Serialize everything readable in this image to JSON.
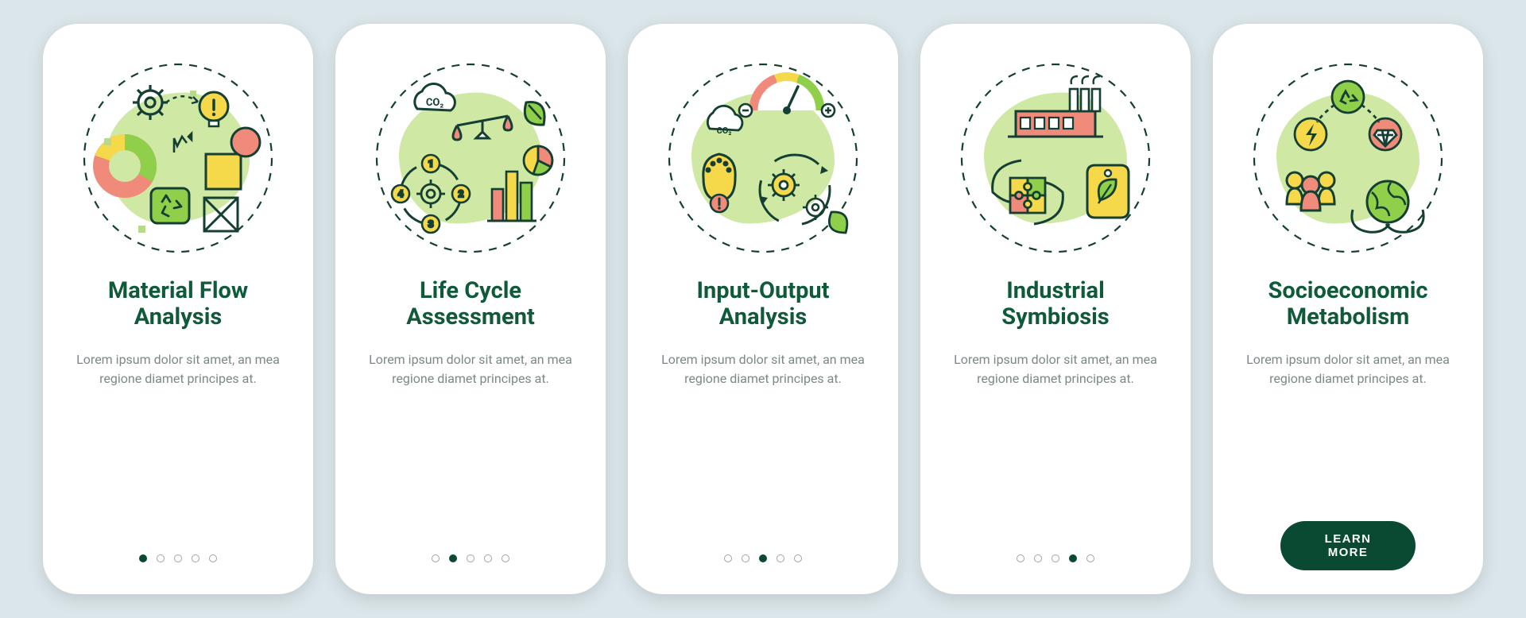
{
  "slide_count": 5,
  "description": "Lorem ipsum dolor sit amet, an mea regione diamet principes at.",
  "cta_label": "LEARN MORE",
  "colors": {
    "dark_green": "#0f5a3a",
    "leaf_green": "#8fcf4a",
    "light_green": "#cfe9a4",
    "yellow": "#f6d94b",
    "red": "#f08a7a",
    "outline": "#153f33"
  },
  "slides": [
    {
      "title": "Material Flow Analysis",
      "icon": "material-flow-analysis-icon",
      "active_index": 0
    },
    {
      "title": "Life Cycle Assessment",
      "icon": "life-cycle-assessment-icon",
      "active_index": 1
    },
    {
      "title": "Input-Output Analysis",
      "icon": "input-output-analysis-icon",
      "active_index": 2
    },
    {
      "title": "Industrial Symbiosis",
      "icon": "industrial-symbiosis-icon",
      "active_index": 3
    },
    {
      "title": "Socioeconomic Metabolism",
      "icon": "socioeconomic-metabolism-icon",
      "active_index": 4
    }
  ]
}
